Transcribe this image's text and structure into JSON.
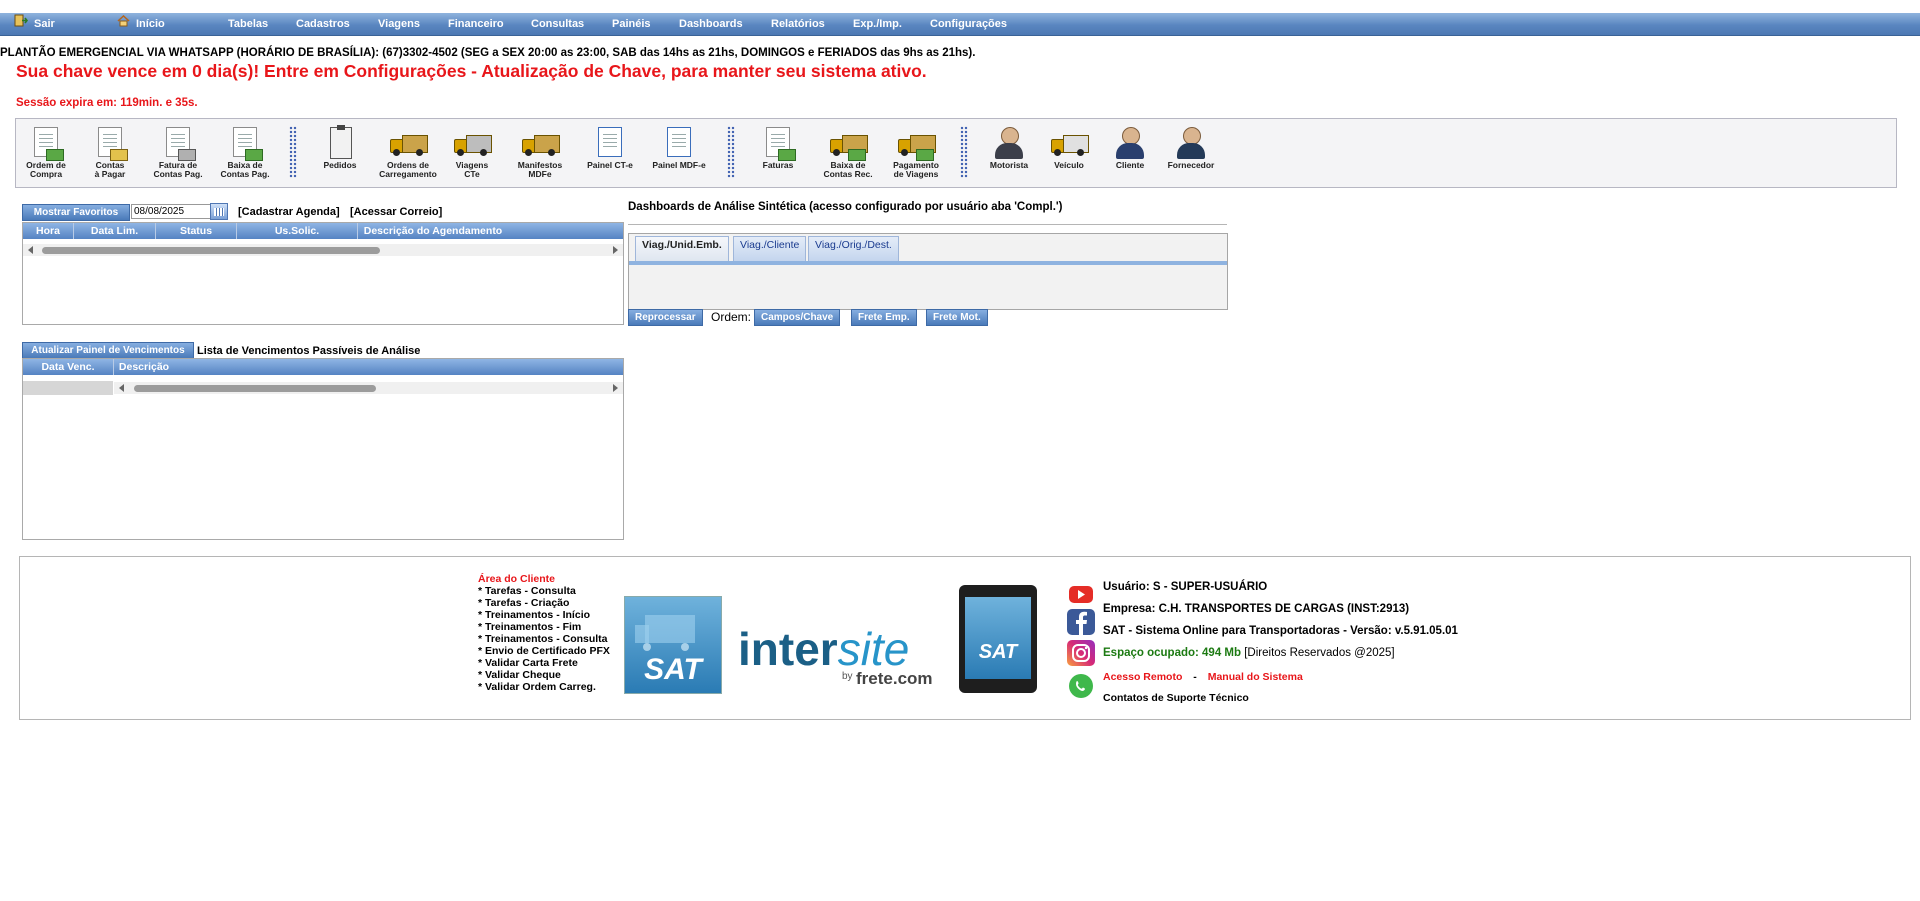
{
  "menu": {
    "sair": "Sair",
    "inicio": "Início",
    "items": [
      "Tabelas",
      "Cadastros",
      "Viagens",
      "Financeiro",
      "Consultas",
      "Painéis",
      "Dashboards",
      "Relatórios",
      "Exp./Imp.",
      "Configurações"
    ]
  },
  "notices": {
    "plantao": "PLANTÃO EMERGENCIAL VIA WHATSAPP (HORÁRIO DE BRASÍLIA): (67)3302-4502 (SEG a SEX 20:00 as 23:00, SAB das 14hs as 21hs, DOMINGOS e FERIADOS das 9hs as 21hs).",
    "aviso": "Sua chave vence em 0 dia(s)! Entre em Configurações - Atualização de Chave, para manter seu sistema ativo.",
    "sessao": "Sessão expira em: 119min. e 35s."
  },
  "toolbar": {
    "group1": [
      "Ordem de\nCompra",
      "Contas\nà Pagar",
      "Fatura de\nContas Pag.",
      "Baixa de\nContas Pag."
    ],
    "group2": [
      "Pedidos",
      "Ordens de\nCarregamento",
      "Viagens\nCTe",
      "Manifestos\nMDFe",
      "Painel CT-e",
      "Painel MDF-e"
    ],
    "group3": [
      "Faturas",
      "Baixa de\nContas Rec.",
      "Pagamento\nde Viagens"
    ],
    "group4": [
      "Motorista",
      "Veículo",
      "Cliente",
      "Fornecedor"
    ]
  },
  "agenda": {
    "favoritos_btn": "Mostrar Favoritos",
    "date": "08/08/2025",
    "cadastrar": "[Cadastrar Agenda]",
    "correio": "[Acessar Correio]",
    "columns": [
      "Hora",
      "Data Lim.",
      "Status",
      "Us.Solic.",
      "Descrição do Agendamento"
    ]
  },
  "vencimentos": {
    "btn": "Atualizar Painel de Vencimentos",
    "title": "Lista de Vencimentos Passíveis de Análise",
    "columns": [
      "Data Venc.",
      "Descrição"
    ]
  },
  "dashboard": {
    "title": "Dashboards de Análise Sintética (acesso configurado por usuário aba 'Compl.')",
    "tabs": [
      "Viag./Unid.Emb.",
      "Viag./Cliente",
      "Viag./Orig./Dest."
    ],
    "reprocessar": "Reprocessar",
    "ordem_label": "Ordem:",
    "ordem_buttons": [
      "Campos/Chave",
      "Frete Emp.",
      "Frete Mot."
    ]
  },
  "footer": {
    "area_cliente": "Área do Cliente",
    "links": [
      "* Tarefas - Consulta",
      "* Tarefas - Criação",
      "* Treinamentos - Início",
      "* Treinamentos - Fim",
      "* Treinamentos - Consulta",
      "* Envio de Certificado PFX",
      "* Validar Carta Frete",
      "* Validar Cheque",
      "* Validar Ordem Carreg."
    ],
    "sat_logo": "SAT",
    "intersite_a": "inter",
    "intersite_b": "site",
    "by": "by",
    "frete": "frete.com",
    "usuario": "Usuário: S - SUPER-USUÁRIO",
    "empresa": "Empresa: C.H. TRANSPORTES DE CARGAS (INST:2913)",
    "versao": "SAT - Sistema Online para Transportadoras - Versão: v.5.91.05.01",
    "espaco": "Espaço ocupado: 494 Mb",
    "direitos": "[Direitos Reservados @2025]",
    "acesso_remoto": "Acesso Remoto",
    "sep": "-",
    "manual": "Manual do Sistema",
    "contatos": "Contatos de Suporte Técnico"
  },
  "colors": {
    "menu_blue": "#5a86c0",
    "alert_red": "#e8161a",
    "green": "#1c7a12"
  }
}
